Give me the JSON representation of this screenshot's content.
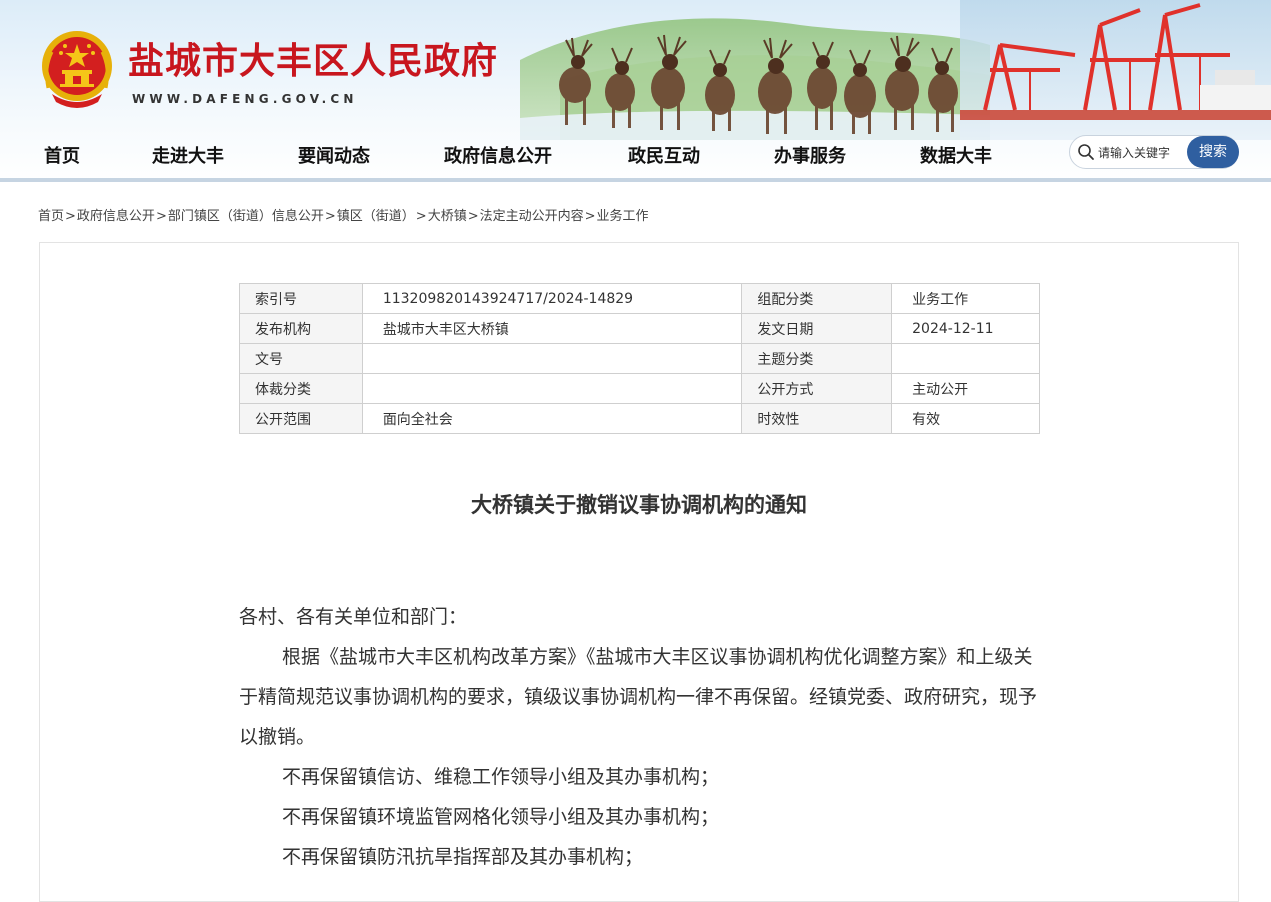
{
  "header": {
    "site_title": "盐城市大丰区人民政府",
    "site_domain": "WWW.DAFENG.GOV.CN"
  },
  "nav": {
    "items": [
      "首页",
      "走进大丰",
      "要闻动态",
      "政府信息公开",
      "政民互动",
      "办事服务",
      "数据大丰"
    ]
  },
  "search": {
    "placeholder": "请输入关键字",
    "button_label": "搜索"
  },
  "breadcrumb": [
    "首页",
    "政府信息公开",
    "部门镇区（街道）信息公开",
    "镇区（街道）",
    "大桥镇",
    "法定主动公开内容",
    "业务工作"
  ],
  "breadcrumb_separator": ">",
  "meta": {
    "rows": [
      [
        "索引号",
        "113209820143924717/2024-14829",
        "组配分类",
        "业务工作"
      ],
      [
        "发布机构",
        "盐城市大丰区大桥镇",
        "发文日期",
        "2024-12-11"
      ],
      [
        "文号",
        "",
        "主题分类",
        ""
      ],
      [
        "体裁分类",
        "",
        "公开方式",
        "主动公开"
      ],
      [
        "公开范围",
        "面向全社会",
        "时效性",
        "有效"
      ]
    ]
  },
  "article": {
    "title": "大桥镇关于撤销议事协调机构的通知",
    "salutation": "各村、各有关单位和部门：",
    "paragraphs": [
      "根据《盐城市大丰区机构改革方案》《盐城市大丰区议事协调机构优化调整方案》和上级关于精简规范议事协调机构的要求，镇级议事协调机构一律不再保留。经镇党委、政府研究，现予以撤销。",
      "不再保留镇信访、维稳工作领导小组及其办事机构；",
      "不再保留镇环境监管网格化领导小组及其办事机构；",
      "不再保留镇防汛抗旱指挥部及其办事机构；"
    ]
  },
  "colors": {
    "title_red": "#c8161e",
    "search_button": "#2f5fa0",
    "table_label_bg": "#f5f5f5"
  }
}
